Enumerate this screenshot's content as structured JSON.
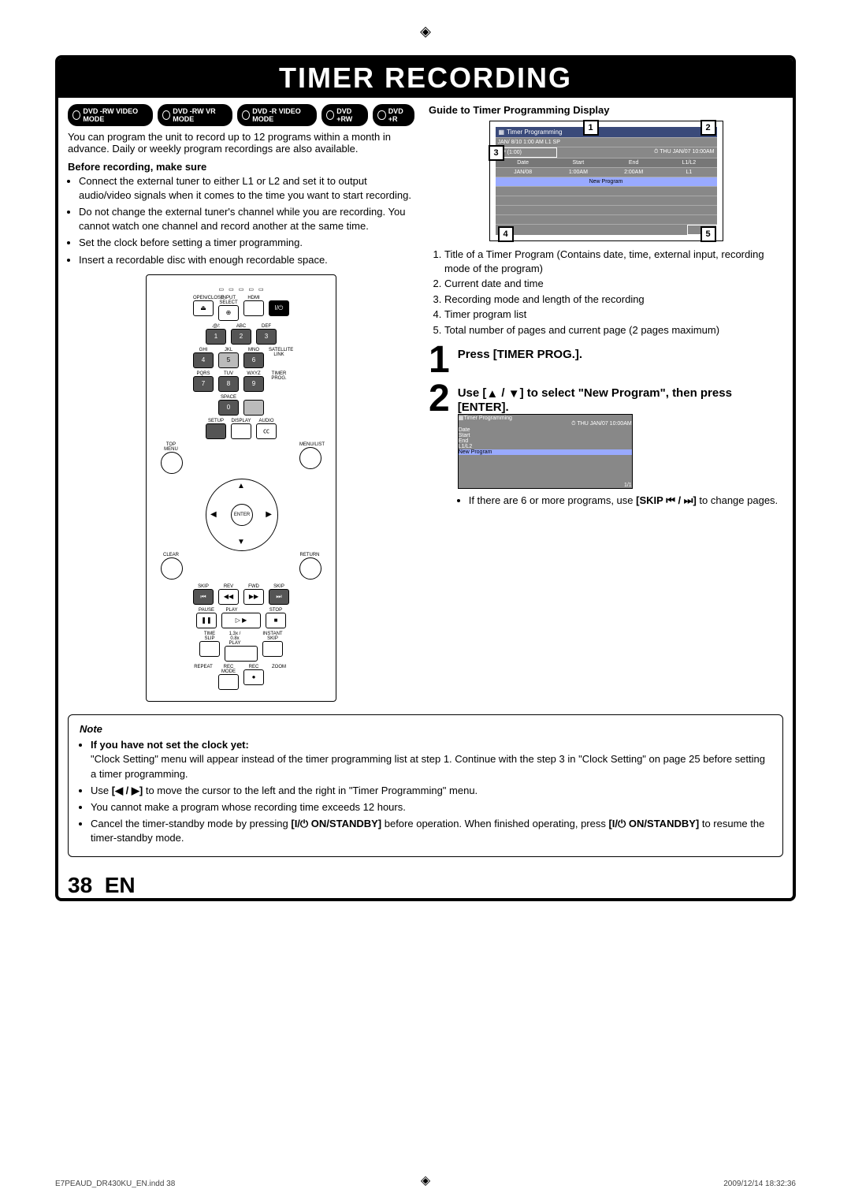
{
  "page_title": "TIMER RECORDING",
  "badges": [
    "DVD -RW VIDEO MODE",
    "DVD -RW VR MODE",
    "DVD -R VIDEO MODE",
    "DVD +RW",
    "DVD +R"
  ],
  "intro": "You can program the unit to record up to 12 programs within a month in advance. Daily or weekly program recordings are also available.",
  "before_h": "Before recording, make sure",
  "before": [
    "Connect the external tuner to either L1 or L2 and set it to output audio/video signals when it comes to the time you want to start recording.",
    "Do not change the external tuner's channel while you are recording. You cannot watch one channel and record another at the same time.",
    "Set the clock before setting a timer programming.",
    "Insert a recordable disc with enough recordable space."
  ],
  "remote": {
    "row1_labels": [
      "OPEN/CLOSE",
      "INPUT SELECT",
      "HDMI"
    ],
    "row2_labels": [
      ".@/:",
      "ABC",
      "DEF"
    ],
    "row3_labels": [
      "GHI",
      "JKL",
      "MNO"
    ],
    "row4_labels": [
      "PQRS",
      "TUV",
      "WXYZ"
    ],
    "side1": "I/⏻",
    "side2": "SATELLITE LINK",
    "side3": "TIMER PROG.",
    "nums": [
      "1",
      "2",
      "3",
      "4",
      "5",
      "6",
      "7",
      "8",
      "9",
      "0"
    ],
    "space": "SPACE",
    "setup": "SETUP",
    "display": "DISPLAY",
    "audio": "AUDIO",
    "cc": "㏄",
    "topmenu": "TOP MENU",
    "menulist": "MENU/LIST",
    "clear": "CLEAR",
    "return": "RETURN",
    "enter": "ENTER",
    "skip": "SKIP",
    "rev": "REV",
    "fwd": "FWD",
    "pause": "PAUSE",
    "play": "PLAY",
    "stop": "STOP",
    "timeslip": "TIME SLIP",
    "x13": "1.3x / 0.8x PLAY",
    "inst": "INSTANT SKIP",
    "repeat": "REPEAT",
    "recmode": "REC MODE",
    "rec": "REC",
    "zoom": "ZOOM"
  },
  "guide_h": "Guide to Timer Programming Display",
  "screen": {
    "title": "Timer Programming",
    "sub_left": "JAN/ 8/10  1:00 AM L1 SP",
    "sub_sp": "SP (1:00)",
    "clock": "THU JAN/07 10:00AM",
    "cols": [
      "Date",
      "Start",
      "End",
      "L1/L2"
    ],
    "row": [
      "JAN/08",
      "1:00AM",
      "2:00AM",
      "L1"
    ],
    "newprog": "New Program",
    "pg": "1/1"
  },
  "guide_list": [
    "Title of a Timer Program (Contains date, time, external input, recording mode of the program)",
    "Current date and time",
    "Recording mode and length of the recording",
    "Timer program list",
    "Total number of pages and current page (2 pages maximum)"
  ],
  "step1": {
    "num": "1",
    "title": "Press [TIMER PROG.]."
  },
  "step2": {
    "num": "2",
    "title_a": "Use [",
    "title_b": " / ",
    "title_c": "] to select \"New Program\", then press [ENTER].",
    "skip_a": "If there are 6 or more programs, use ",
    "skip_b": "[SKIP ",
    "skip_c": " / ",
    "skip_d": "]",
    "skip_e": " to change pages."
  },
  "note": {
    "h": "Note",
    "l1b": "If you have not set the clock yet:",
    "l1": "\"Clock Setting\" menu will appear instead of the timer programming list at step 1. Continue with the step 3 in \"Clock Setting\" on page 25 before setting a timer programming.",
    "l2a": "Use ",
    "l2b": "[◀ / ▶]",
    "l2c": " to move the cursor to the left and the right in \"Timer Programming\" menu.",
    "l3": "You cannot make a program whose recording time exceeds 12 hours.",
    "l4a": "Cancel the timer-standby mode by pressing ",
    "l4b": "[I/⏻ ON/STANDBY]",
    "l4c": " before operation. When finished operating, press ",
    "l4d": "[I/⏻ ON/STANDBY]",
    "l4e": " to resume the timer-standby mode."
  },
  "page_num": "38",
  "page_lang": "EN",
  "footer_left": "E7PEAUD_DR430KU_EN.indd   38",
  "footer_right": "2009/12/14   18:32:36"
}
